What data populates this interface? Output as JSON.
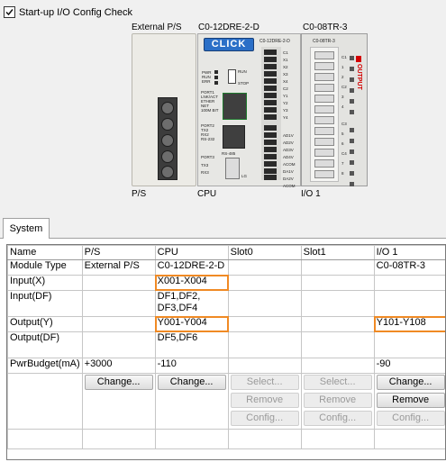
{
  "startup_check": {
    "label": "Start-up I/O Config Check",
    "checked": true
  },
  "hardware": {
    "ps_top_label": "External P/S",
    "ps_bottom_label": "P/S",
    "cpu_top_label": "C0-12DRE-2-D",
    "cpu_bottom_label": "CPU",
    "io_top_label": "C0-08TR-3",
    "io_bottom_label": "I/O 1",
    "cpu_logo": "CLICK",
    "cpu_face_model": "C0-12DRE-2-D",
    "io_face_model": "C0-08TR-3",
    "io_face_word": "OUTPUT",
    "cpu_leds": [
      "PWR",
      "RUN",
      "ERR"
    ],
    "cpu_switch": [
      "RUN",
      "STOP"
    ],
    "cpu_ports": [
      "PORT1",
      "LNK/ACT",
      "ETHER",
      "NET",
      "100M BIT",
      "PORT2",
      "TX2",
      "RX2",
      "RS-232",
      "PORT3",
      "RS-485",
      "TX3",
      "RX3",
      "LG"
    ],
    "cpu_terminals": [
      "C1",
      "X1",
      "X2",
      "X3",
      "X4",
      "C2",
      "Y1",
      "Y2",
      "Y3",
      "Y4",
      "AD1V",
      "AD2V",
      "AD3V",
      "AD4V",
      "ACOM",
      "DA1V",
      "DA2V",
      "ACOM"
    ],
    "io_terminals": [
      "C1",
      "1",
      "2",
      "C2",
      "3",
      "4",
      "C3",
      "5",
      "6",
      "C4",
      "7",
      "8"
    ],
    "accent_orange": "#f08a24",
    "logo_blue": "#2b6fc7",
    "output_red": "#d40000"
  },
  "tabs": [
    {
      "label": "System",
      "active": true
    }
  ],
  "table": {
    "headers": [
      "Name",
      "P/S",
      "CPU",
      "Slot0",
      "Slot1",
      "I/O 1"
    ],
    "rows": [
      {
        "name": "Module Type",
        "ps": "External P/S",
        "cpu": "C0-12DRE-2-D",
        "slot0": "",
        "slot1": "",
        "io1": "C0-08TR-3"
      },
      {
        "name": "Input(X)",
        "ps": "",
        "cpu": "X001-X004",
        "slot0": "",
        "slot1": "",
        "io1": ""
      },
      {
        "name": "Input(DF)",
        "ps": "",
        "cpu": "DF1,DF2,\nDF3,DF4",
        "slot0": "",
        "slot1": "",
        "io1": ""
      },
      {
        "name": "Output(Y)",
        "ps": "",
        "cpu": "Y001-Y004",
        "slot0": "",
        "slot1": "",
        "io1": "Y101-Y108"
      },
      {
        "name": "Output(DF)",
        "ps": "",
        "cpu": "DF5,DF6",
        "slot0": "",
        "slot1": "",
        "io1": ""
      },
      {
        "name": "PwrBudget(mA)",
        "ps": "+3000",
        "cpu": "-110",
        "slot0": "",
        "slot1": "",
        "io1": "-90"
      }
    ],
    "buttons": {
      "ps": [
        "Change..."
      ],
      "cpu": [
        "Change..."
      ],
      "slot0": [
        "Select...",
        "Remove",
        "Config..."
      ],
      "slot1": [
        "Select...",
        "Remove",
        "Config..."
      ],
      "io1": [
        "Change...",
        "Remove",
        "Config..."
      ]
    }
  }
}
